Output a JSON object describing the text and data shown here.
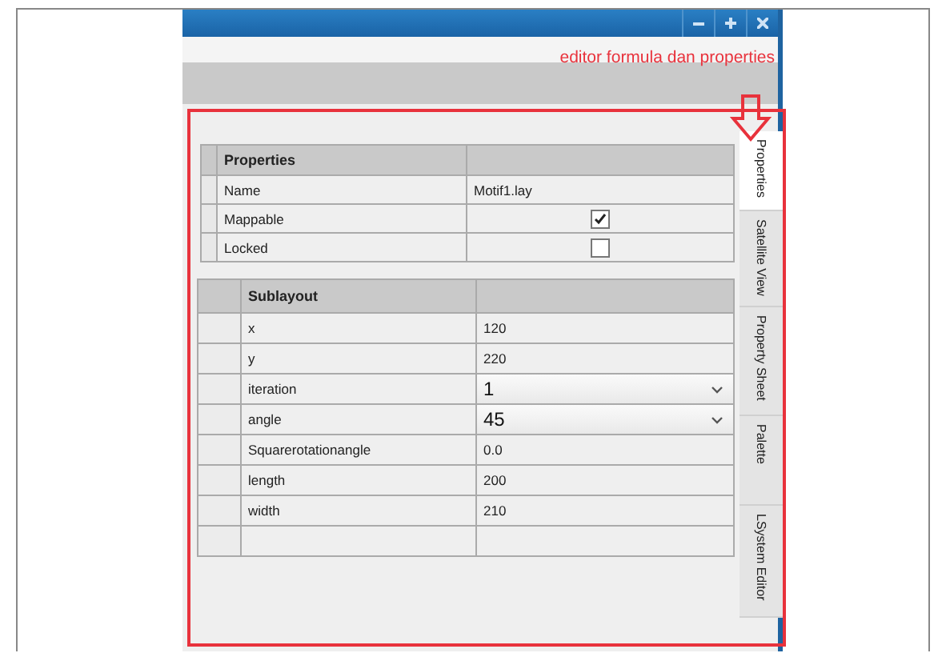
{
  "annotation": {
    "text": "editor formula dan properties"
  },
  "properties_table": {
    "header": "Properties",
    "rows": [
      {
        "name": "Name",
        "kind": "text",
        "value": "Motif1.lay"
      },
      {
        "name": "Mappable",
        "kind": "checkbox",
        "checked": true
      },
      {
        "name": "Locked",
        "kind": "checkbox",
        "checked": false
      }
    ]
  },
  "sublayout_table": {
    "header": "Sublayout",
    "rows": [
      {
        "name": "x",
        "kind": "text",
        "value": "120"
      },
      {
        "name": "y",
        "kind": "text",
        "value": "220"
      },
      {
        "name": "iteration",
        "kind": "dropdown",
        "value": "1"
      },
      {
        "name": "angle",
        "kind": "dropdown",
        "value": "45"
      },
      {
        "name": "Squarerotationangle",
        "kind": "text",
        "value": "0.0"
      },
      {
        "name": "length",
        "kind": "text",
        "value": "200"
      },
      {
        "name": "width",
        "kind": "text",
        "value": "210"
      },
      {
        "kind": "empty"
      }
    ]
  },
  "side_tabs": [
    {
      "label": "Properties",
      "selected": true
    },
    {
      "label": "Satellite View",
      "selected": false
    },
    {
      "label": "Property Sheet",
      "selected": false
    },
    {
      "label": "Palette",
      "selected": false
    },
    {
      "label": "LSystem Editor",
      "selected": false
    }
  ]
}
